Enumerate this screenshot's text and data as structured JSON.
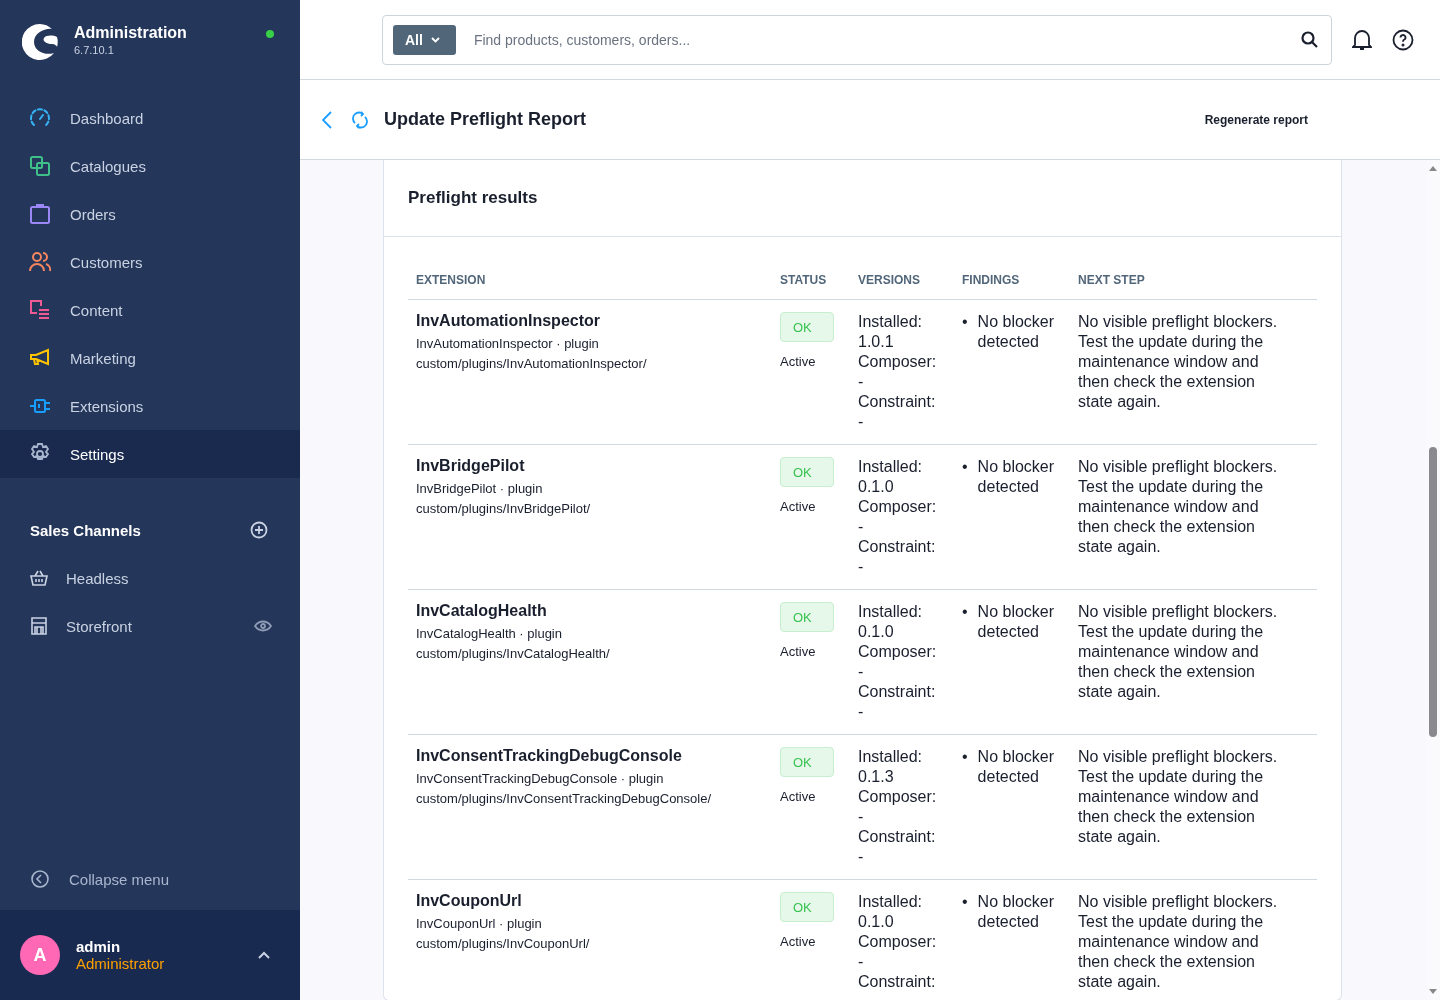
{
  "sidebar": {
    "brand": {
      "title": "Administration",
      "version": "6.7.10.1",
      "online": true
    },
    "nav": [
      {
        "label": "Dashboard",
        "color": "#36b3f5",
        "selected": false
      },
      {
        "label": "Catalogues",
        "color": "#3fbf8a",
        "selected": false
      },
      {
        "label": "Orders",
        "color": "#9b87f5",
        "selected": false
      },
      {
        "label": "Customers",
        "color": "#f5855f",
        "selected": false
      },
      {
        "label": "Content",
        "color": "#ee5a93",
        "selected": false
      },
      {
        "label": "Marketing",
        "color": "#ffc400",
        "selected": false
      },
      {
        "label": "Extensions",
        "color": "#189eff",
        "selected": false
      },
      {
        "label": "Settings",
        "color": "#a9b6cf",
        "selected": true
      }
    ],
    "sales_channels": {
      "title": "Sales Channels",
      "items": [
        {
          "label": "Headless",
          "kind": "basket"
        },
        {
          "label": "Storefront",
          "kind": "store"
        }
      ]
    },
    "collapse": "Collapse menu",
    "user": {
      "initial": "A",
      "name": "admin",
      "role": "Administrator"
    }
  },
  "search": {
    "scope": "All",
    "placeholder": "Find products, customers, orders..."
  },
  "page": {
    "title": "Update Preflight Report",
    "action": "Regenerate report"
  },
  "card": {
    "title": "Preflight results",
    "columns": [
      "EXTENSION",
      "STATUS",
      "VERSIONS",
      "FINDINGS",
      "NEXT STEP"
    ],
    "rows": [
      {
        "name": "InvAutomationInspector",
        "meta": "InvAutomationInspector · plugin",
        "path": "custom/plugins/InvAutomationInspector/",
        "badge": "OK",
        "state": "Active",
        "versions": [
          {
            "label": "Installed:",
            "value": "1.0.1"
          },
          {
            "label": "Composer:",
            "value": "-"
          },
          {
            "label": "Constraint:",
            "value": "-"
          }
        ],
        "findings": [
          {
            "bullet": "•",
            "text": "No blocker detected"
          }
        ],
        "next_step": "No visible preflight blockers. Test the update during the maintenance window and then check the extension state again."
      },
      {
        "name": "InvBridgePilot",
        "meta": "InvBridgePilot · plugin",
        "path": "custom/plugins/InvBridgePilot/",
        "badge": "OK",
        "state": "Active",
        "versions": [
          {
            "label": "Installed:",
            "value": "0.1.0"
          },
          {
            "label": "Composer:",
            "value": "-"
          },
          {
            "label": "Constraint:",
            "value": "-"
          }
        ],
        "findings": [
          {
            "bullet": "•",
            "text": "No blocker detected"
          }
        ],
        "next_step": "No visible preflight blockers. Test the update during the maintenance window and then check the extension state again."
      },
      {
        "name": "InvCatalogHealth",
        "meta": "InvCatalogHealth · plugin",
        "path": "custom/plugins/InvCatalogHealth/",
        "badge": "OK",
        "state": "Active",
        "versions": [
          {
            "label": "Installed:",
            "value": "0.1.0"
          },
          {
            "label": "Composer:",
            "value": "-"
          },
          {
            "label": "Constraint:",
            "value": "-"
          }
        ],
        "findings": [
          {
            "bullet": "•",
            "text": "No blocker detected"
          }
        ],
        "next_step": "No visible preflight blockers. Test the update during the maintenance window and then check the extension state again."
      },
      {
        "name": "InvConsentTrackingDebugConsole",
        "meta": "InvConsentTrackingDebugConsole · plugin",
        "path": "custom/plugins/InvConsentTrackingDebugConsole/",
        "badge": "OK",
        "state": "Active",
        "versions": [
          {
            "label": "Installed:",
            "value": "0.1.3"
          },
          {
            "label": "Composer:",
            "value": "-"
          },
          {
            "label": "Constraint:",
            "value": "-"
          }
        ],
        "findings": [
          {
            "bullet": "•",
            "text": "No blocker detected"
          }
        ],
        "next_step": "No visible preflight blockers. Test the update during the maintenance window and then check the extension state again."
      },
      {
        "name": "InvCouponUrl",
        "meta": "InvCouponUrl · plugin",
        "path": "custom/plugins/InvCouponUrl/",
        "badge": "OK",
        "state": "Active",
        "versions": [
          {
            "label": "Installed:",
            "value": "0.1.0"
          },
          {
            "label": "Composer:",
            "value": "-"
          },
          {
            "label": "Constraint:"
          }
        ],
        "findings": [
          {
            "bullet": "•",
            "text": "No blocker detected"
          }
        ],
        "next_step": "No visible preflight blockers. Test the update during the maintenance window and then check the extension state again."
      }
    ]
  }
}
